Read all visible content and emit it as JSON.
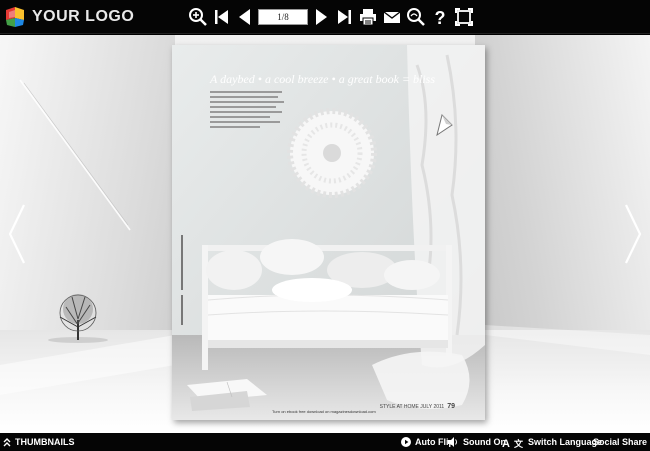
{
  "header": {
    "logo_text": "YOUR LOGO",
    "page_indicator": "1/8",
    "toolbar_icons": [
      "zoom-in-icon",
      "first-page-icon",
      "previous-page-icon",
      "next-page-icon",
      "last-page-icon",
      "print-icon",
      "email-icon",
      "search-icon",
      "help-icon",
      "fullscreen-icon"
    ]
  },
  "book": {
    "headline": "A daybed • a cool breeze • a great book = bliss",
    "footer_note": "Turn on ebook free download on magazinesdownload.com",
    "folio_label": "STYLE AT HOME  JULY 2011",
    "folio_number": "79"
  },
  "footer": {
    "thumbnails": "THUMBNAILS",
    "auto_flip": "Auto Flip",
    "sound_on": "Sound On",
    "switch_language": "Switch Language",
    "social_share": "Social Share"
  },
  "colors": {
    "toolbar_bg": "#050505",
    "icon_white": "#ffffff"
  }
}
